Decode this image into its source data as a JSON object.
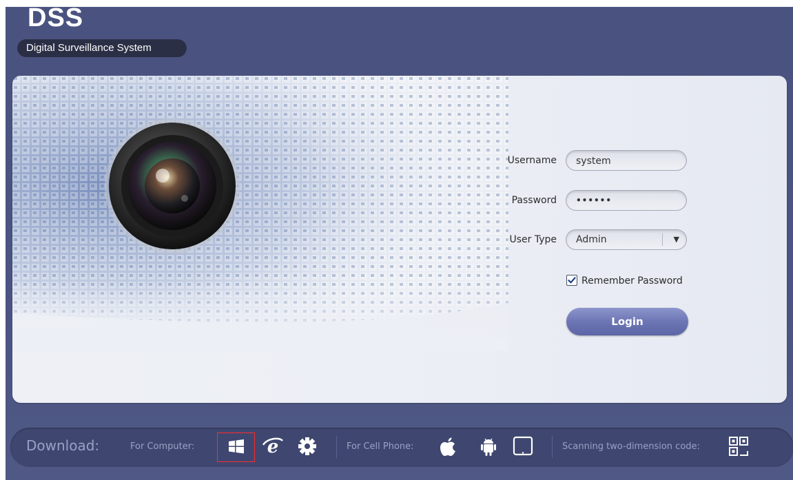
{
  "brand": {
    "title": "DSS",
    "subtitle": "Digital Surveillance System"
  },
  "login": {
    "username_label": "Username",
    "username_value": "system",
    "password_label": "Password",
    "password_value": "••••••",
    "usertype_label": "User Type",
    "usertype_value": "Admin",
    "remember_label": "Remember Password",
    "remember_checked": true,
    "login_button": "Login"
  },
  "download": {
    "title": "Download:",
    "for_computer": "For Computer:",
    "for_cell_phone": "For Cell Phone:",
    "scanning": "Scanning two-dimension code:",
    "computer_icons": [
      "windows-icon",
      "internet-explorer-icon",
      "gear-icon"
    ],
    "phone_icons": [
      "apple-icon",
      "android-icon",
      "tablet-icon"
    ],
    "qr_icon": "qr-code-icon",
    "selected_icon": "windows-icon"
  },
  "colors": {
    "background": "#4b5482",
    "panel": "#eceff5",
    "login_button": "#6d76b4",
    "download_bar": "#3f4770",
    "download_text": "#9aa1c6",
    "selection_highlight": "#ff2a2a"
  }
}
